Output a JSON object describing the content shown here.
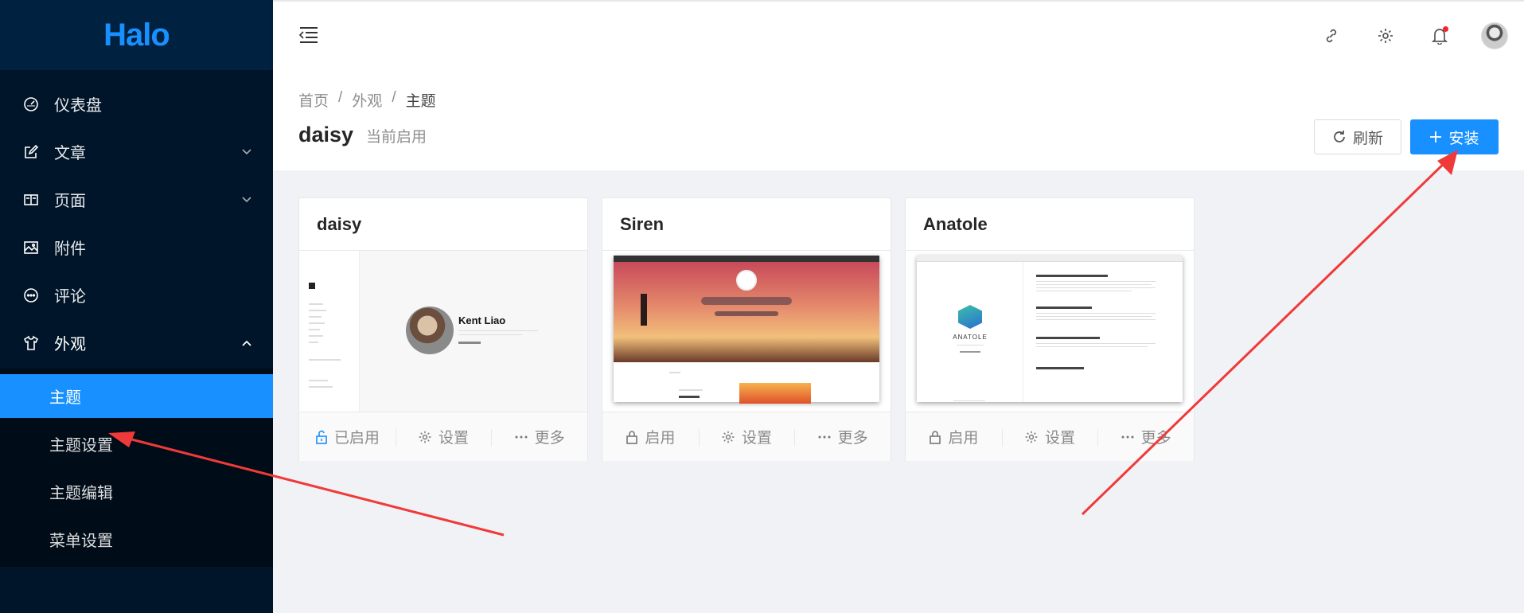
{
  "brand": "Halo",
  "sidebar": {
    "items": [
      {
        "label": "仪表盘",
        "icon": "dashboard-icon"
      },
      {
        "label": "文章",
        "icon": "edit-icon"
      },
      {
        "label": "页面",
        "icon": "book-icon"
      },
      {
        "label": "附件",
        "icon": "picture-icon"
      },
      {
        "label": "评论",
        "icon": "comment-icon"
      },
      {
        "label": "外观",
        "icon": "skin-icon"
      }
    ],
    "sub_items": [
      "主题",
      "主题设置",
      "主题编辑",
      "菜单设置"
    ]
  },
  "header": {
    "icons": [
      "link-icon",
      "gear-icon",
      "bell-icon",
      "avatar"
    ]
  },
  "breadcrumb": [
    "首页",
    "外观",
    "主题"
  ],
  "page": {
    "title": "daisy",
    "subtitle": "当前启用",
    "refresh_label": "刷新",
    "install_label": "安装"
  },
  "themes": [
    {
      "name": "daisy",
      "enable_label": "已启用",
      "settings_label": "设置",
      "more_label": "更多",
      "cover_author": "Kent Liao"
    },
    {
      "name": "Siren",
      "enable_label": "启用",
      "settings_label": "设置",
      "more_label": "更多"
    },
    {
      "name": "Anatole",
      "enable_label": "启用",
      "settings_label": "设置",
      "more_label": "更多",
      "cover_logo_text": "ANATOLE"
    }
  ],
  "colors": {
    "sidebar_bg": "#001529",
    "accent": "#1890ff",
    "annotation_arrow": "#f03a3a"
  }
}
